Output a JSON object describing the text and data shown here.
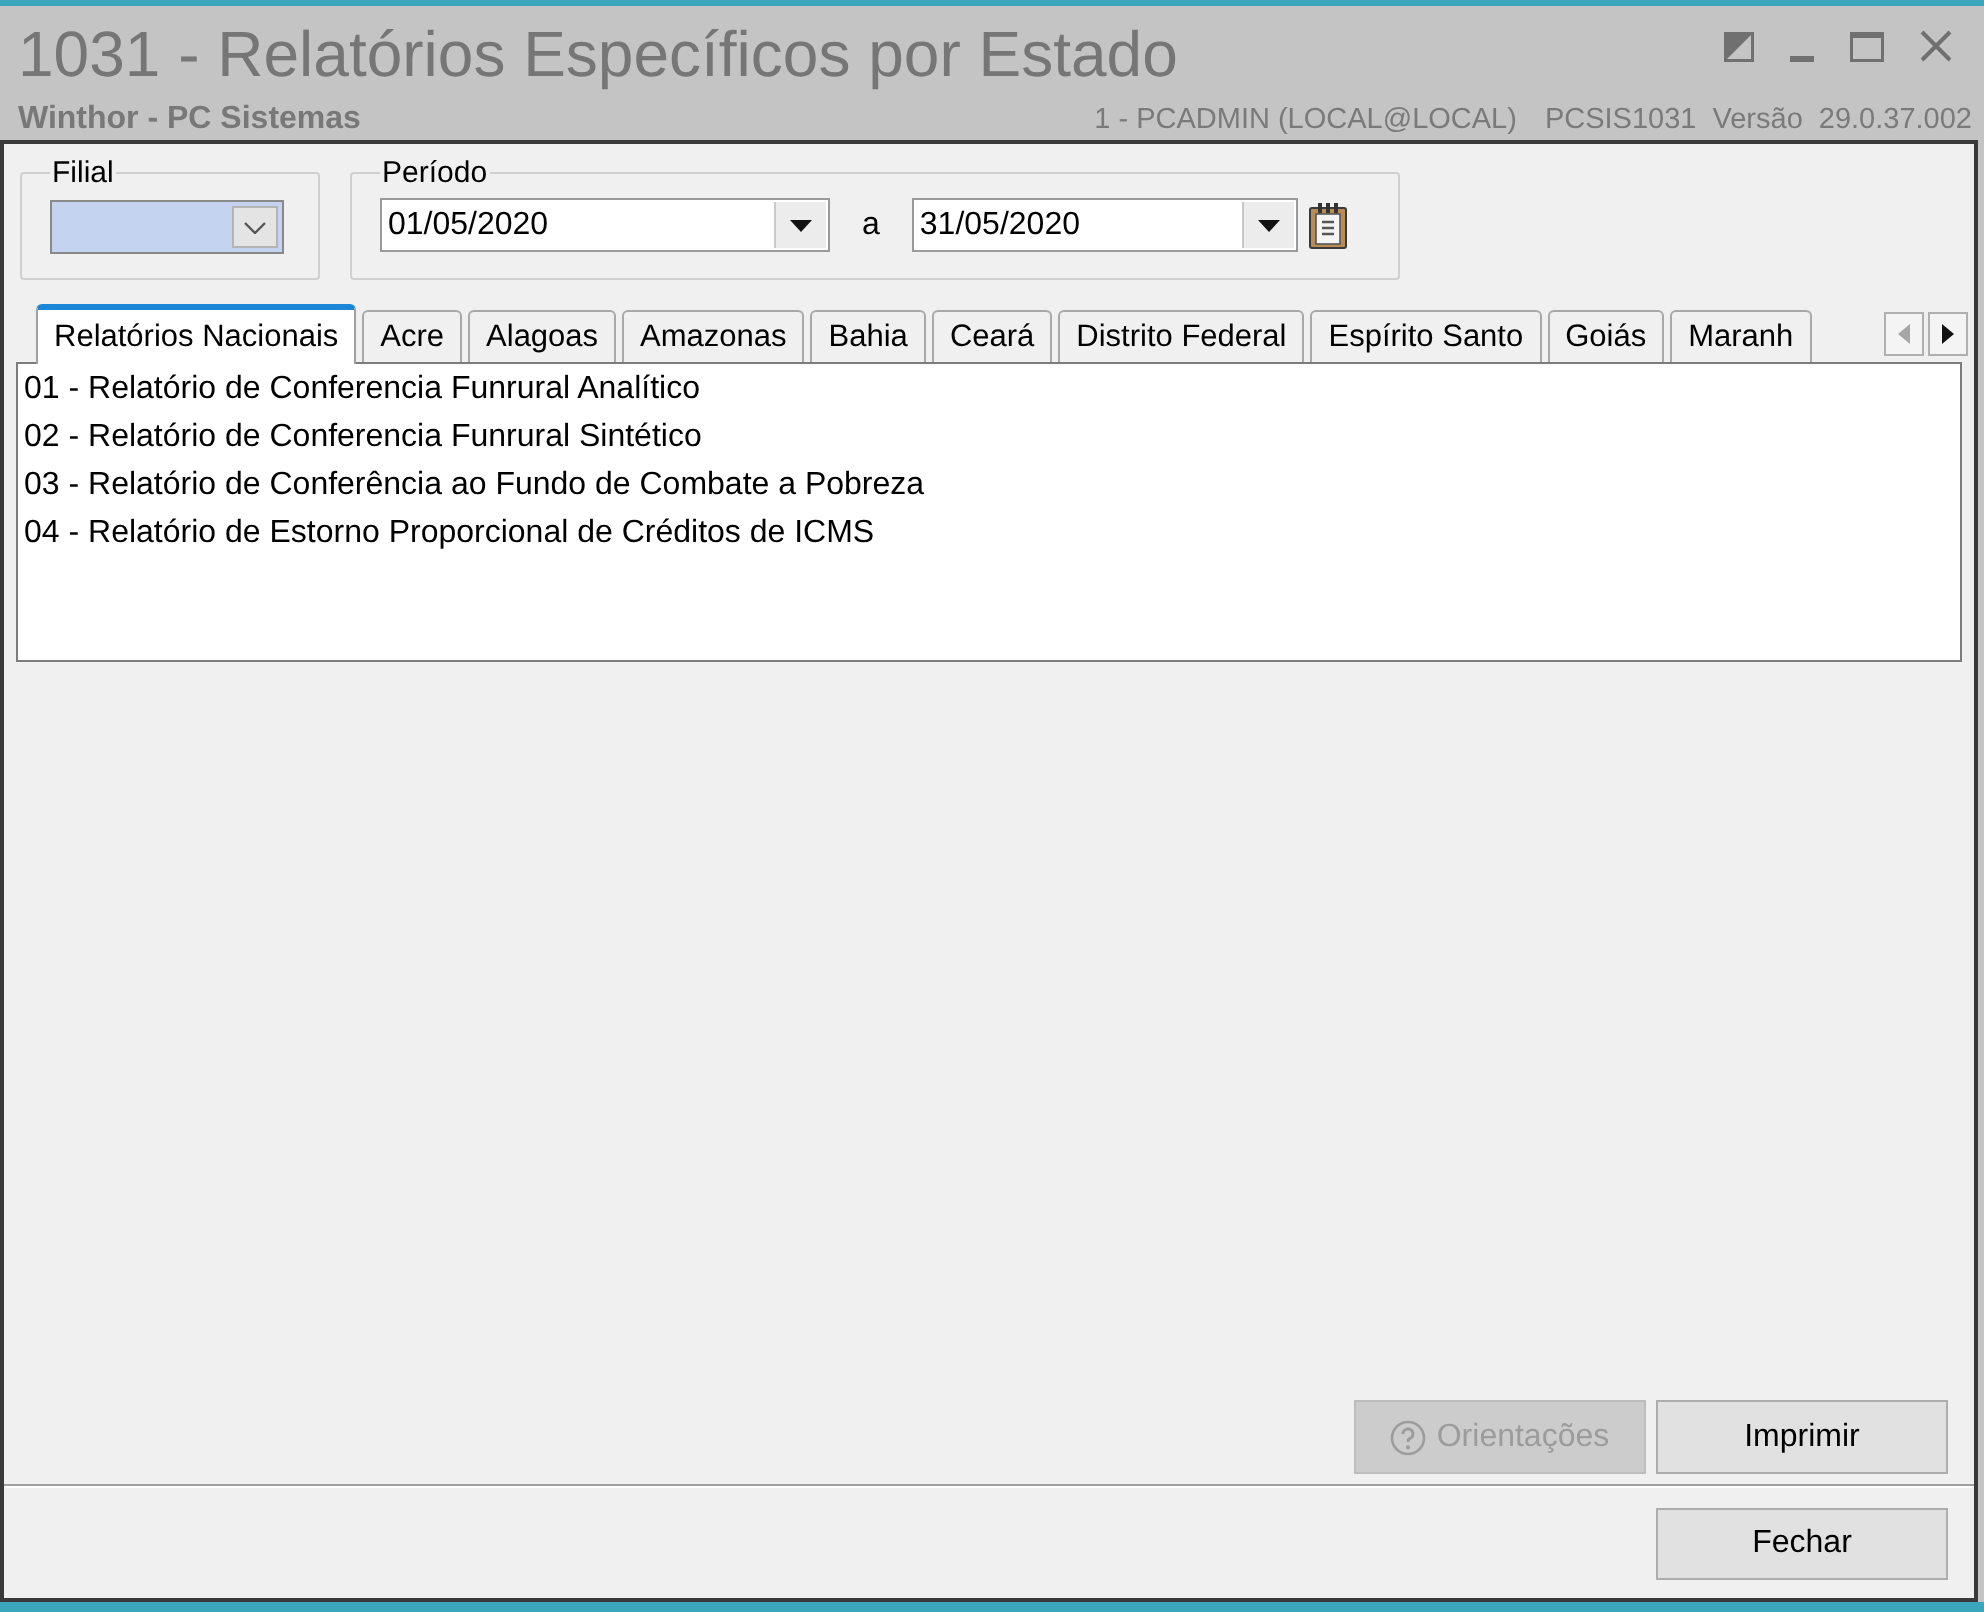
{
  "window": {
    "title": "1031 - Relatórios Específicos por Estado",
    "subtitle": "Winthor - PC Sistemas",
    "user": "1 - PCADMIN (LOCAL@LOCAL)",
    "program": "PCSIS1031",
    "version_label": "Versão",
    "version": "29.0.37.002"
  },
  "filial": {
    "label": "Filial",
    "focused": true
  },
  "periodo": {
    "label": "Período",
    "start": "01/05/2020",
    "separator": "a",
    "end": "31/05/2020"
  },
  "tabs": [
    {
      "label": "Relatórios Nacionais",
      "selected": true
    },
    {
      "label": "Acre",
      "selected": false
    },
    {
      "label": "Alagoas",
      "selected": false
    },
    {
      "label": "Amazonas",
      "selected": false
    },
    {
      "label": "Bahia",
      "selected": false
    },
    {
      "label": "Ceará",
      "selected": false
    },
    {
      "label": "Distrito Federal",
      "selected": false
    },
    {
      "label": "Espírito Santo",
      "selected": false
    },
    {
      "label": "Goiás",
      "selected": false
    },
    {
      "label": "Maranh",
      "selected": false
    }
  ],
  "tab_scroll": [
    {
      "kind": "left",
      "disabled": true
    },
    {
      "kind": "right",
      "disabled": false
    }
  ],
  "reports": [
    "01 - Relatório de Conferencia Funrural Analítico",
    "02 - Relatório de Conferencia Funrural Sintético",
    "03 - Relatório de Conferência ao Fundo de Combate a Pobreza",
    "04 - Relatório de Estorno Proporcional de Créditos de ICMS"
  ],
  "actions": [
    {
      "label": "Orientações",
      "kind": "help",
      "disabled": true
    },
    {
      "label": "Imprimir",
      "kind": "plain",
      "disabled": false
    }
  ],
  "footer_buttons": [
    {
      "label": "Fechar",
      "disabled": false
    }
  ]
}
